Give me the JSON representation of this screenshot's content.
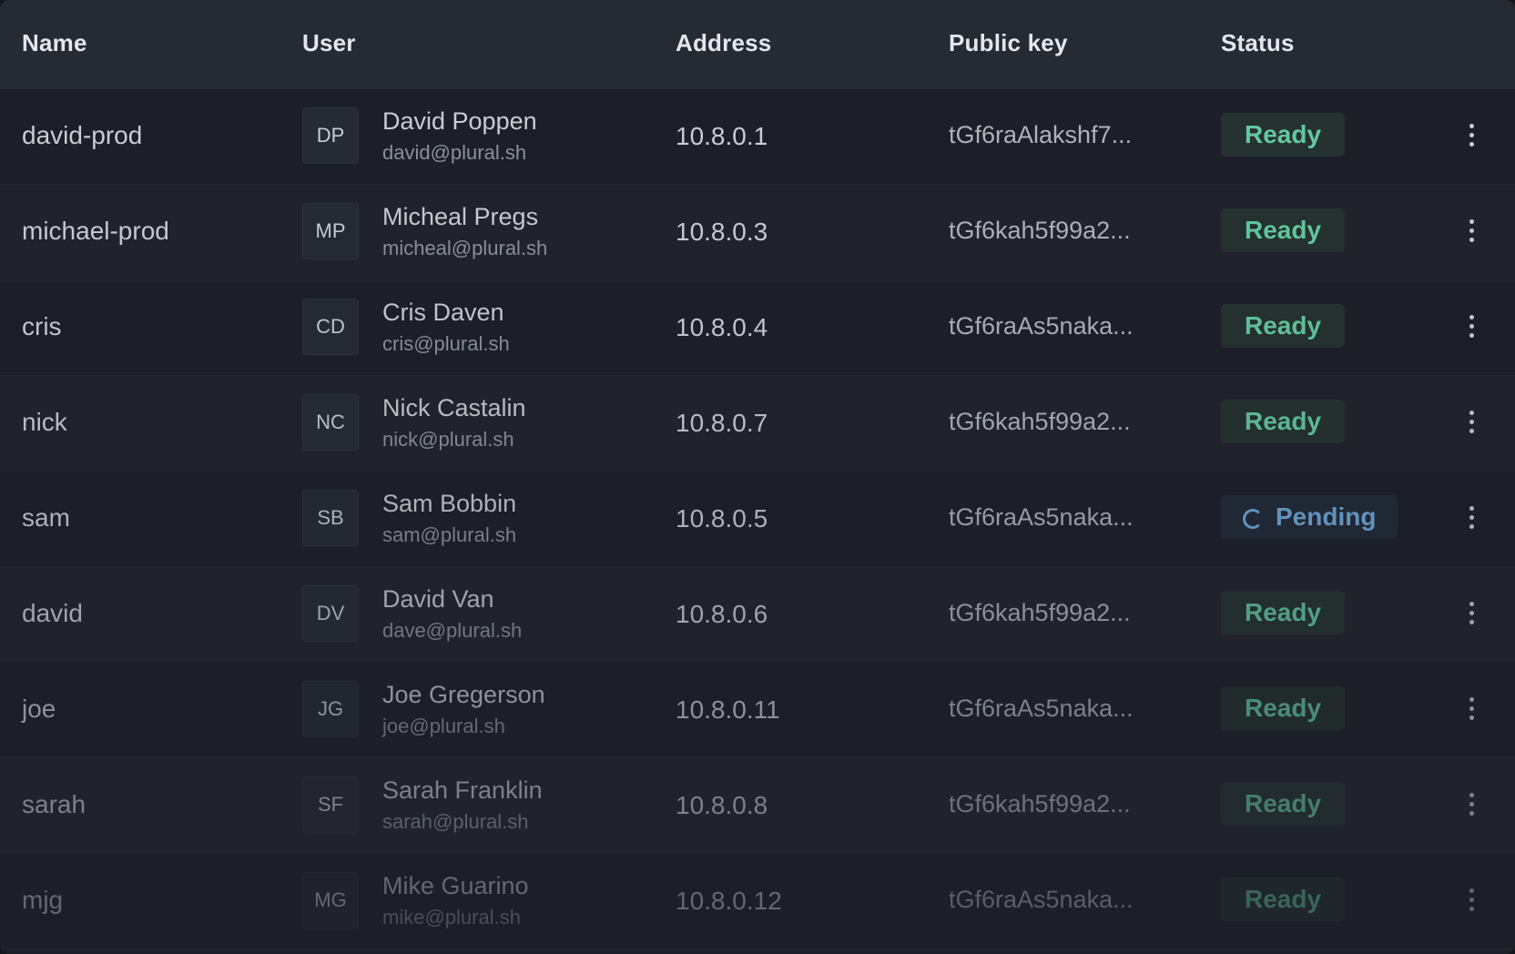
{
  "headers": {
    "name": "Name",
    "user": "User",
    "address": "Address",
    "public_key": "Public key",
    "status": "Status"
  },
  "rows": [
    {
      "name": "david-prod",
      "initials": "DP",
      "user_name": "David Poppen",
      "email": "david@plural.sh",
      "address": "10.8.0.1",
      "public_key": "tGf6raAlakshf7...",
      "status": "Ready"
    },
    {
      "name": "michael-prod",
      "initials": "MP",
      "user_name": "Micheal Pregs",
      "email": "micheal@plural.sh",
      "address": "10.8.0.3",
      "public_key": "tGf6kah5f99a2...",
      "status": "Ready"
    },
    {
      "name": "cris",
      "initials": "CD",
      "user_name": "Cris Daven",
      "email": "cris@plural.sh",
      "address": "10.8.0.4",
      "public_key": "tGf6raAs5naka...",
      "status": "Ready"
    },
    {
      "name": "nick",
      "initials": "NC",
      "user_name": "Nick Castalin",
      "email": "nick@plural.sh",
      "address": "10.8.0.7",
      "public_key": "tGf6kah5f99a2...",
      "status": "Ready"
    },
    {
      "name": "sam",
      "initials": "SB",
      "user_name": "Sam Bobbin",
      "email": "sam@plural.sh",
      "address": "10.8.0.5",
      "public_key": "tGf6raAs5naka...",
      "status": "Pending"
    },
    {
      "name": "david",
      "initials": "DV",
      "user_name": "David Van",
      "email": "dave@plural.sh",
      "address": "10.8.0.6",
      "public_key": "tGf6kah5f99a2...",
      "status": "Ready"
    },
    {
      "name": "joe",
      "initials": "JG",
      "user_name": "Joe Gregerson",
      "email": "joe@plural.sh",
      "address": "10.8.0.11",
      "public_key": "tGf6raAs5naka...",
      "status": "Ready"
    },
    {
      "name": "sarah",
      "initials": "SF",
      "user_name": "Sarah Franklin",
      "email": "sarah@plural.sh",
      "address": "10.8.0.8",
      "public_key": "tGf6kah5f99a2...",
      "status": "Ready"
    },
    {
      "name": "mjg",
      "initials": "MG",
      "user_name": "Mike Guarino",
      "email": "mike@plural.sh",
      "address": "10.8.0.12",
      "public_key": "tGf6raAs5naka...",
      "status": "Ready"
    }
  ],
  "icons": {
    "menu": "more-vertical-icon",
    "pending": "spinner-icon"
  },
  "colors": {
    "ready": "#63c7a1",
    "pending": "#6fa8d8",
    "background": "#1c1f27",
    "header_background": "#262a33"
  }
}
